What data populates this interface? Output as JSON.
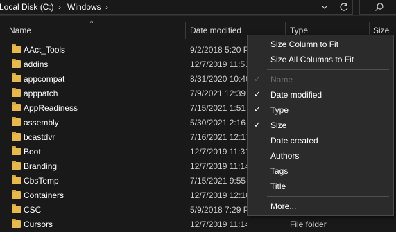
{
  "address_bar": {
    "crumbs": [
      "Local Disk (C:)",
      "Windows"
    ]
  },
  "columns": {
    "name": "Name",
    "date_modified": "Date modified",
    "type": "Type",
    "size": "Size"
  },
  "files": [
    {
      "name": "AAct_Tools",
      "date": "9/2/2018 5:20 PM",
      "type": ""
    },
    {
      "name": "addins",
      "date": "12/7/2019 11:51 AM",
      "type": ""
    },
    {
      "name": "appcompat",
      "date": "8/31/2020 10:40 AM",
      "type": ""
    },
    {
      "name": "apppatch",
      "date": "7/9/2021 12:39 AM",
      "type": ""
    },
    {
      "name": "AppReadiness",
      "date": "7/15/2021 1:51 PM",
      "type": ""
    },
    {
      "name": "assembly",
      "date": "5/30/2021 2:16 PM",
      "type": ""
    },
    {
      "name": "bcastdvr",
      "date": "7/16/2021 12:17 PM",
      "type": ""
    },
    {
      "name": "Boot",
      "date": "12/7/2019 11:31 AM",
      "type": ""
    },
    {
      "name": "Branding",
      "date": "12/7/2019 11:14 AM",
      "type": ""
    },
    {
      "name": "CbsTemp",
      "date": "7/15/2021 9:55 AM",
      "type": ""
    },
    {
      "name": "Containers",
      "date": "12/7/2019 12:16 PM",
      "type": ""
    },
    {
      "name": "CSC",
      "date": "5/9/2018 7:29 PM",
      "type": ""
    },
    {
      "name": "Cursors",
      "date": "12/7/2019 11:14 AM",
      "type": "File folder"
    }
  ],
  "context_menu": {
    "size_column_to_fit": "Size Column to Fit",
    "size_all_columns_to_fit": "Size All Columns to Fit",
    "items": [
      {
        "label": "Name",
        "checked": true,
        "disabled": true
      },
      {
        "label": "Date modified",
        "checked": true,
        "disabled": false
      },
      {
        "label": "Type",
        "checked": true,
        "disabled": false
      },
      {
        "label": "Size",
        "checked": true,
        "disabled": false
      },
      {
        "label": "Date created",
        "checked": false,
        "disabled": false
      },
      {
        "label": "Authors",
        "checked": false,
        "disabled": false
      },
      {
        "label": "Tags",
        "checked": false,
        "disabled": false
      },
      {
        "label": "Title",
        "checked": false,
        "disabled": false
      }
    ],
    "more": "More...",
    "check_glyph": "✓"
  },
  "icons": {
    "chevron": "chevron-right-icon",
    "dropdown": "chevron-down-icon",
    "refresh": "refresh-icon",
    "search": "search-icon",
    "sort": "sort-up-icon",
    "folder": "folder-icon"
  },
  "colors": {
    "background": "#191919",
    "menu_background": "#2b2b2b",
    "folder": "#e8b84a",
    "disabled_text": "#6d6d6d"
  }
}
